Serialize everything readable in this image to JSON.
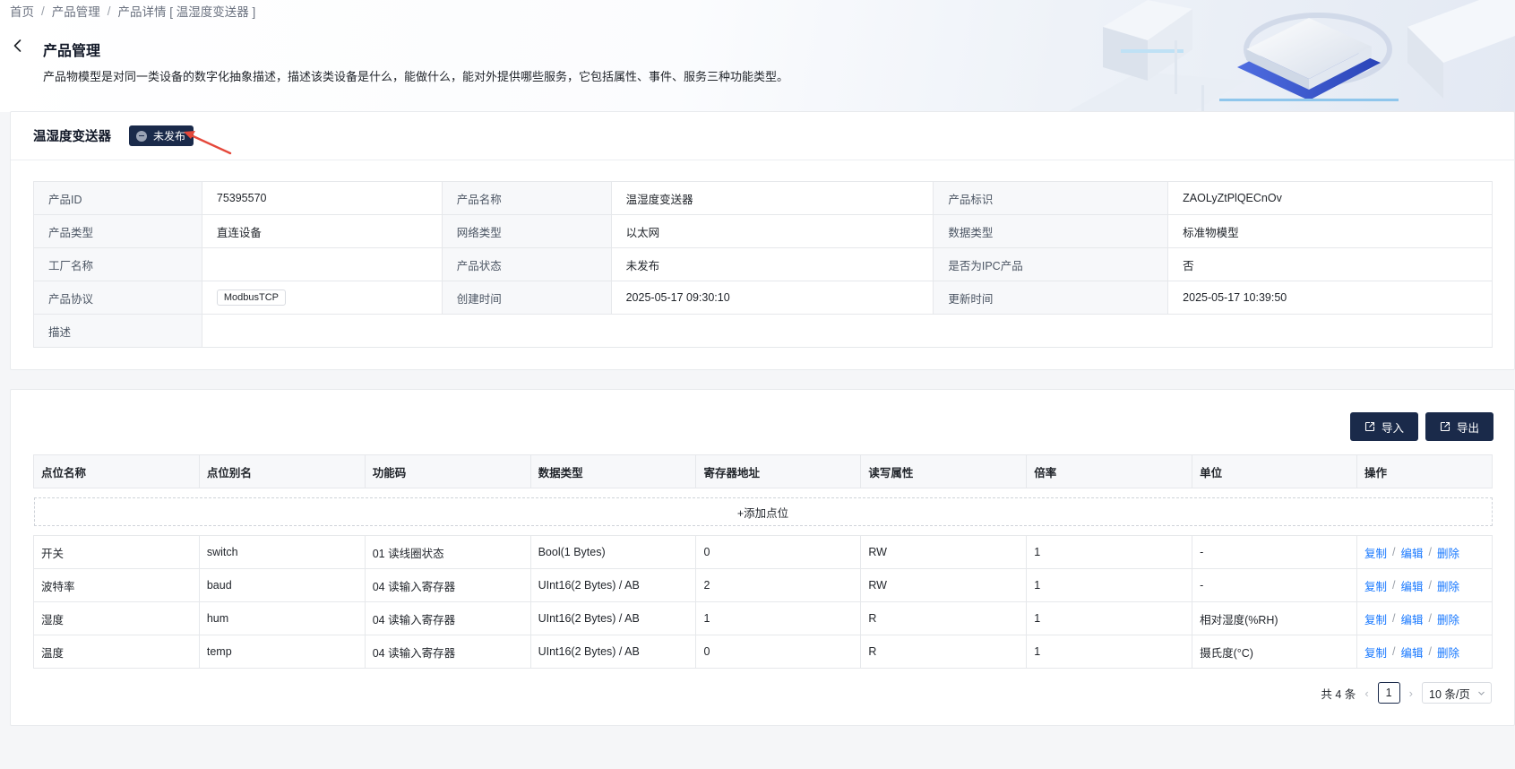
{
  "breadcrumb": [
    "首页",
    "产品管理",
    "产品详情 [ 温湿度变送器 ]"
  ],
  "page": {
    "title": "产品管理",
    "description": "产品物模型是对同一类设备的数字化抽象描述，描述该类设备是什么，能做什么，能对外提供哪些服务，它包括属性、事件、服务三种功能类型。"
  },
  "product": {
    "name": "温湿度变送器",
    "status_badge": "未发布",
    "fields": {
      "id_label": "产品ID",
      "id_value": "75395570",
      "name_label": "产品名称",
      "name_value": "温湿度变送器",
      "key_label": "产品标识",
      "key_value": "ZAOLyZtPlQECnOv",
      "type_label": "产品类型",
      "type_value": "直连设备",
      "network_label": "网络类型",
      "network_value": "以太网",
      "data_label": "数据类型",
      "data_value": "标准物模型",
      "factory_label": "工厂名称",
      "factory_value": "",
      "state_label": "产品状态",
      "state_value": "未发布",
      "ipc_label": "是否为IPC产品",
      "ipc_value": "否",
      "protocol_label": "产品协议",
      "protocol_value": "ModbusTCP",
      "created_label": "创建时间",
      "created_value": "2025-05-17 09:30:10",
      "updated_label": "更新时间",
      "updated_value": "2025-05-17 10:39:50",
      "desc_label": "描述",
      "desc_value": ""
    }
  },
  "toolbar": {
    "import_label": "导入",
    "export_label": "导出"
  },
  "points": {
    "headers": [
      "点位名称",
      "点位别名",
      "功能码",
      "数据类型",
      "寄存器地址",
      "读写属性",
      "倍率",
      "单位",
      "操作"
    ],
    "add_label": "+添加点位",
    "ops": {
      "copy": "复制",
      "edit": "编辑",
      "delete": "删除",
      "sep": "/"
    },
    "rows": [
      [
        "开关",
        "switch",
        "01 读线圈状态",
        "Bool(1 Bytes)",
        "0",
        "RW",
        "1",
        "-"
      ],
      [
        "波特率",
        "baud",
        "04 读输入寄存器",
        "UInt16(2 Bytes) / AB",
        "2",
        "RW",
        "1",
        "-"
      ],
      [
        "湿度",
        "hum",
        "04 读输入寄存器",
        "UInt16(2 Bytes) / AB",
        "1",
        "R",
        "1",
        "相对湿度(%RH)"
      ],
      [
        "温度",
        "temp",
        "04 读输入寄存器",
        "UInt16(2 Bytes) / AB",
        "0",
        "R",
        "1",
        "摄氏度(°C)"
      ]
    ]
  },
  "pagination": {
    "total": "共 4 条",
    "current_page": "1",
    "page_size": "10 条/页"
  },
  "colors": {
    "primary_dark": "#1a2a4a",
    "link": "#1677ff",
    "annotation_arrow": "#e5483b"
  }
}
